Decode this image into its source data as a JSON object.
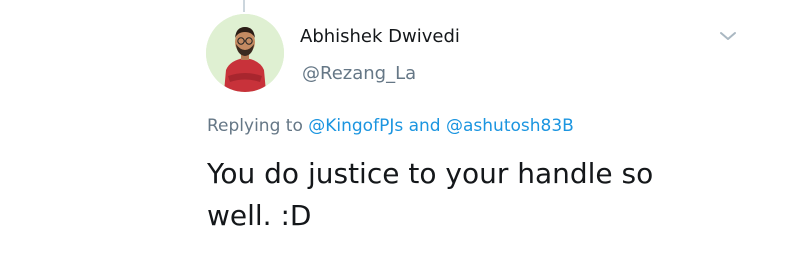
{
  "tweet": {
    "author": {
      "display_name": "Abhishek Dwivedi",
      "handle": "@Rezang_La"
    },
    "reply_context": {
      "prefix": "Replying to",
      "mentions": [
        "@KingofPJs",
        "@ashutosh83B"
      ],
      "joiner": "and"
    },
    "text": "You do justice to your handle so well. :D",
    "menu_icon": "chevron-down-icon"
  },
  "colors": {
    "text_primary": "#14171a",
    "text_secondary": "#657786",
    "link": "#1b95e0",
    "avatar_background": "#dff0d2"
  }
}
